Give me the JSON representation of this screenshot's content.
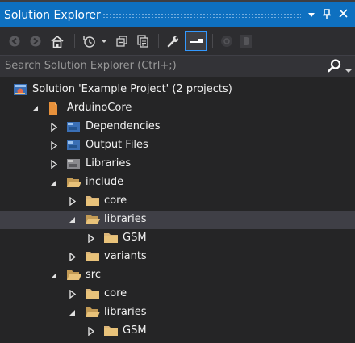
{
  "panel": {
    "title": "Solution Explorer",
    "pin_glyph": "↕",
    "close_glyph": "✕"
  },
  "search": {
    "placeholder": "Search Solution Explorer (Ctrl+;)"
  },
  "icons": {
    "back": "back-arrow-icon",
    "forward": "forward-arrow-icon",
    "home": "home-icon",
    "history": "history-icon",
    "collapse": "collapse-all-icon",
    "sync": "sync-with-active-document-icon",
    "properties": "wrench-icon",
    "preview": "preview-selected-items-icon",
    "search": "search-icon"
  },
  "colors": {
    "title_bar": "#0e70c0",
    "background": "#252526",
    "selected_row": "#3f3f46",
    "folder": "#dcb67a"
  },
  "tree": [
    {
      "label": "Solution 'Example Project' (2 projects)",
      "indent": 0,
      "arrow": "none",
      "icon": "solution",
      "selected": false
    },
    {
      "label": "ArduinoCore",
      "indent": 1,
      "arrow": "expanded",
      "icon": "project",
      "selected": false
    },
    {
      "label": "Dependencies",
      "indent": 2,
      "arrow": "collapsed",
      "icon": "virtual-folder",
      "selected": false
    },
    {
      "label": "Output Files",
      "indent": 2,
      "arrow": "collapsed",
      "icon": "virtual-folder",
      "selected": false
    },
    {
      "label": "Libraries",
      "indent": 2,
      "arrow": "collapsed",
      "icon": "library",
      "selected": false
    },
    {
      "label": "include",
      "indent": 2,
      "arrow": "expanded",
      "icon": "folder-open",
      "selected": false
    },
    {
      "label": "core",
      "indent": 3,
      "arrow": "collapsed",
      "icon": "folder",
      "selected": false
    },
    {
      "label": "libraries",
      "indent": 3,
      "arrow": "expanded",
      "icon": "folder-open",
      "selected": true
    },
    {
      "label": "GSM",
      "indent": 4,
      "arrow": "collapsed",
      "icon": "folder",
      "selected": false
    },
    {
      "label": "variants",
      "indent": 3,
      "arrow": "collapsed",
      "icon": "folder",
      "selected": false
    },
    {
      "label": "src",
      "indent": 2,
      "arrow": "expanded",
      "icon": "folder-open",
      "selected": false
    },
    {
      "label": "core",
      "indent": 3,
      "arrow": "collapsed",
      "icon": "folder",
      "selected": false
    },
    {
      "label": "libraries",
      "indent": 3,
      "arrow": "expanded",
      "icon": "folder-open",
      "selected": false
    },
    {
      "label": "GSM",
      "indent": 4,
      "arrow": "collapsed",
      "icon": "folder",
      "selected": false
    }
  ]
}
